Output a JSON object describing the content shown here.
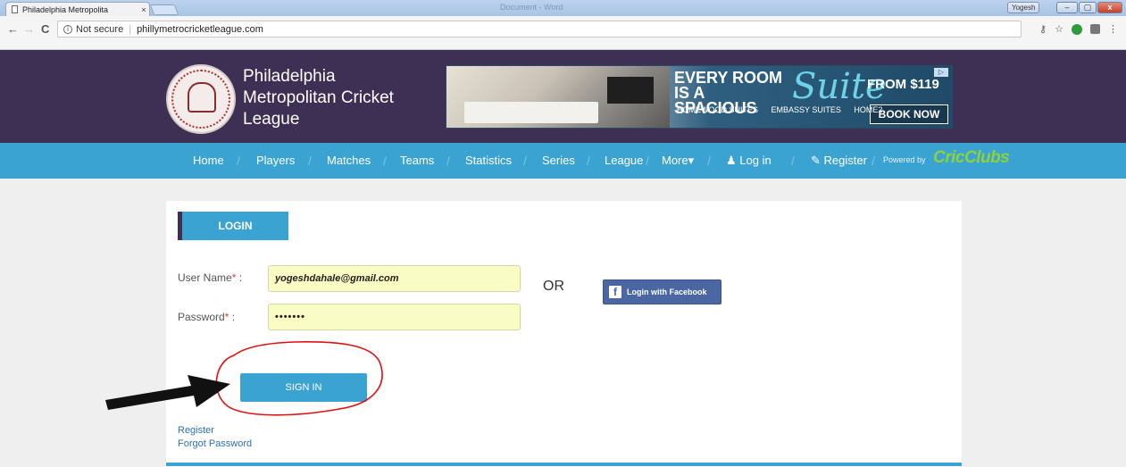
{
  "browser": {
    "tab_title": "Philadelphia Metropolita",
    "tab_close": "×",
    "window_title": "Document - Word",
    "user_chip": "Yogesh",
    "win_min": "–",
    "win_max": "▢",
    "win_close": "x",
    "back_glyph": "←",
    "forward_glyph": "→",
    "reload_glyph": "C",
    "security_text": "Not secure",
    "url": "phillymetrocricketleague.com",
    "key_glyph": "⚷",
    "star_glyph": "☆",
    "menu_glyph": "⋮"
  },
  "header": {
    "site_name": "Philadelphia Metropolitan Cricket League",
    "ad": {
      "headline": "EVERY ROOM IS A SPACIOUS",
      "script_word": "Suite",
      "price": "FROM $119",
      "cta": "BOOK NOW",
      "brands": [
        "HOMEWOOD SUITES",
        "EMBASSY SUITES",
        "HOME2"
      ]
    }
  },
  "nav": {
    "items": [
      "Home",
      "Players",
      "Matches",
      "Teams",
      "Statistics",
      "Series",
      "League",
      "More▾",
      "Log in",
      "Register"
    ],
    "powered_by": "Powered by",
    "brand": "CricClubs"
  },
  "login": {
    "tab_label": "LOGIN",
    "username_label": "User Name",
    "password_label": "Password",
    "required_mark": "*",
    "colon": " :",
    "username_value": "yogeshdahale@gmail.com",
    "password_value": "•••••••",
    "or_text": "OR",
    "facebook_label": "Login with Facebook",
    "signin_label": "SIGN IN",
    "register_link": "Register",
    "forgot_link": "Forgot Password"
  },
  "colors": {
    "header_bg": "#3e3054",
    "nav_bg": "#3aa3d1",
    "field_bg": "#fafdc3",
    "annotation_red": "#e01010"
  }
}
